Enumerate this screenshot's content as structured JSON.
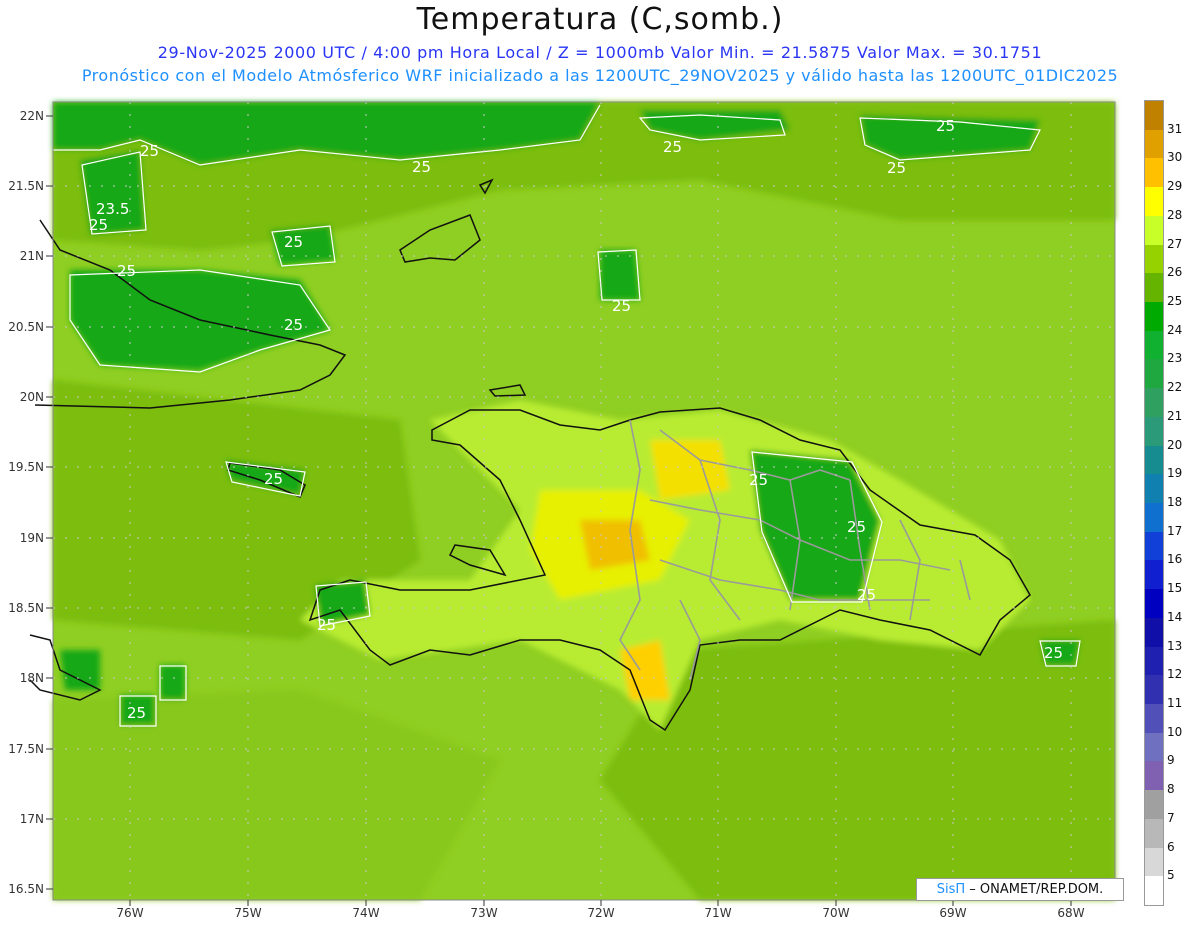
{
  "header": {
    "title": "Temperatura (C,somb.)",
    "subtitle1": "29-Nov-2025  2000 UTC / 4:00 pm Hora Local / Z = 1000mb   Valor Min. = 21.5875  Valor Max. = 30.1751",
    "subtitle2": "Pronóstico con el Modelo Atmósferico WRF inicializado a las 1200UTC_29NOV2025 y válido hasta las  1200UTC_01DIC2025"
  },
  "map": {
    "lat_ticks": [
      "22N",
      "21.5N",
      "21N",
      "20.5N",
      "20N",
      "19.5N",
      "19N",
      "18.5N",
      "18N",
      "17.5N",
      "17N",
      "16.5N"
    ],
    "lon_ticks": [
      "76W",
      "75W",
      "74W",
      "73W",
      "72W",
      "71W",
      "70W",
      "69W",
      "68W"
    ],
    "contour_labels": [
      "25",
      "25",
      "25",
      "25",
      "25",
      "23.5",
      "25",
      "25",
      "25",
      "25",
      "25",
      "25",
      "25",
      "25",
      "25",
      "25",
      "25",
      "25"
    ]
  },
  "colorbar": {
    "labels": [
      "31",
      "30",
      "29",
      "28",
      "27",
      "26",
      "25",
      "24",
      "23",
      "22",
      "21",
      "20",
      "19",
      "18",
      "17",
      "16",
      "15",
      "14",
      "13",
      "12",
      "11",
      "10",
      "9",
      "8",
      "7",
      "6",
      "5"
    ],
    "colors": [
      "#c08000",
      "#e0a000",
      "#ffc000",
      "#ffff00",
      "#c8ff28",
      "#96d200",
      "#64b400",
      "#00aa00",
      "#10b030",
      "#20a840",
      "#30a060",
      "#2a9a78",
      "#168c90",
      "#1080b0",
      "#1070d0",
      "#1040d8",
      "#1020d0",
      "#0000c0",
      "#1010a8",
      "#2020b0",
      "#3030b0",
      "#5050b8",
      "#7070c0",
      "#8060b0",
      "#a0a0a0",
      "#b8b8b8",
      "#d8d8d8",
      "#ffffff"
    ]
  },
  "credit": {
    "brand": "SisΠ",
    "text": "– ONAMET/REP.DOM."
  }
}
